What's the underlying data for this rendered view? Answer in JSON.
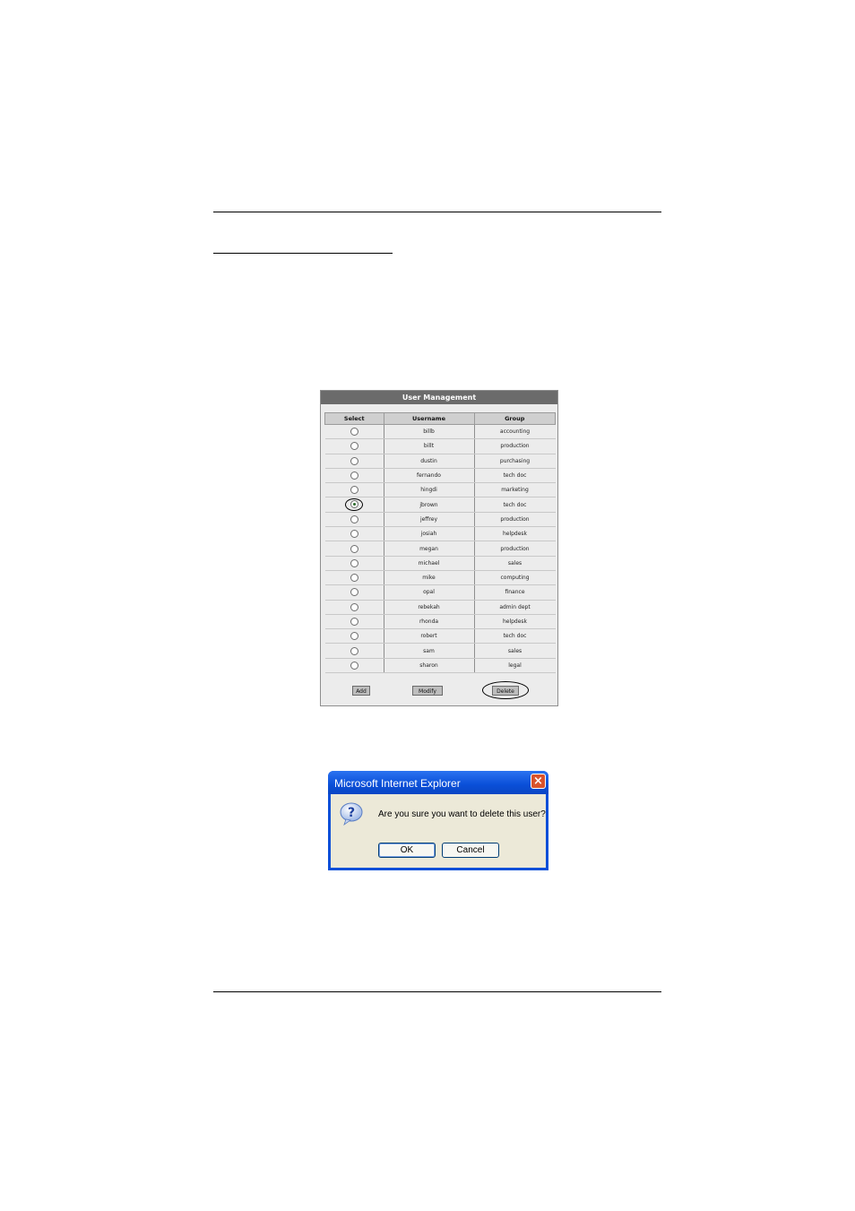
{
  "panel": {
    "title": "User Management",
    "headers": {
      "select": "Select",
      "username": "Username",
      "group": "Group"
    },
    "rows": [
      {
        "username": "billb",
        "group": "accounting",
        "selected": false
      },
      {
        "username": "billt",
        "group": "production",
        "selected": false
      },
      {
        "username": "dustin",
        "group": "purchasing",
        "selected": false
      },
      {
        "username": "fernando",
        "group": "tech doc",
        "selected": false
      },
      {
        "username": "hingdi",
        "group": "marketing",
        "selected": false
      },
      {
        "username": "jbrown",
        "group": "tech doc",
        "selected": true
      },
      {
        "username": "jeffrey",
        "group": "production",
        "selected": false
      },
      {
        "username": "josiah",
        "group": "helpdesk",
        "selected": false
      },
      {
        "username": "megan",
        "group": "production",
        "selected": false
      },
      {
        "username": "michael",
        "group": "sales",
        "selected": false
      },
      {
        "username": "mike",
        "group": "computing",
        "selected": false
      },
      {
        "username": "opal",
        "group": "finance",
        "selected": false
      },
      {
        "username": "rebekah",
        "group": "admin dept",
        "selected": false
      },
      {
        "username": "rhonda",
        "group": "helpdesk",
        "selected": false
      },
      {
        "username": "robert",
        "group": "tech doc",
        "selected": false
      },
      {
        "username": "sam",
        "group": "sales",
        "selected": false
      },
      {
        "username": "sharon",
        "group": "legal",
        "selected": false
      }
    ],
    "buttons": {
      "add": "Add",
      "modify": "Modify",
      "delete": "Delete"
    }
  },
  "dialog": {
    "title": "Microsoft Internet Explorer",
    "message": "Are you sure you want to delete this user?",
    "ok": "OK",
    "cancel": "Cancel",
    "close_glyph": "×",
    "icon": "question-icon"
  }
}
